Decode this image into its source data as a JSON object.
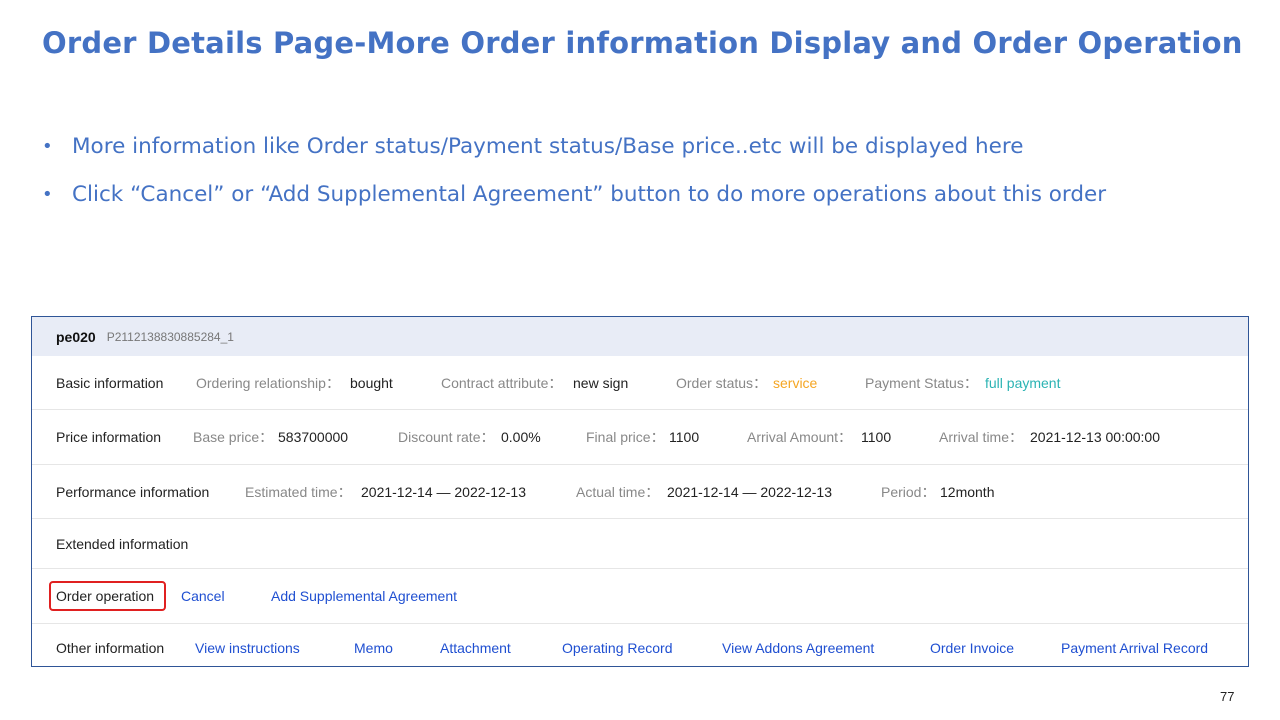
{
  "slide": {
    "title": "Order Details Page-More Order information Display and Order Operation",
    "bullet_char": "•",
    "bullets": [
      "More information like Order status/Payment status/Base price..etc will be displayed here",
      "Click “Cancel” or “Add Supplemental Agreement” button to do more operations about this order"
    ],
    "page_number": "77"
  },
  "order": {
    "name": "pe020",
    "code": "P2112138830885284_1",
    "basic": {
      "label": "Basic information",
      "ordering_relationship_key": "Ordering relationship：",
      "ordering_relationship_val": "bought",
      "contract_attribute_key": "Contract attribute：",
      "contract_attribute_val": "new sign",
      "order_status_key": "Order status：",
      "order_status_val": "service",
      "payment_status_key": "Payment Status：",
      "payment_status_val": "full payment"
    },
    "price": {
      "label": "Price information",
      "base_price_key": "Base price：",
      "base_price_val": "583700000",
      "discount_rate_key": "Discount rate：",
      "discount_rate_val": "0.00%",
      "final_price_key": "Final price：",
      "final_price_val": "1100",
      "arrival_amount_key": "Arrival Amount：",
      "arrival_amount_val": "1100",
      "arrival_time_key": "Arrival time：",
      "arrival_time_val": "2021-12-13 00:00:00"
    },
    "performance": {
      "label": "Performance information",
      "estimated_time_key": "Estimated time：",
      "estimated_time_val": "2021-12-14 — 2022-12-13",
      "actual_time_key": "Actual time：",
      "actual_time_val": "2021-12-14 — 2022-12-13",
      "period_key": "Period：",
      "period_val": "12month"
    },
    "extended": {
      "label": "Extended information"
    },
    "operation": {
      "label": "Order operation",
      "cancel": "Cancel",
      "add_supplemental": "Add Supplemental Agreement"
    },
    "other": {
      "label": "Other information",
      "links": [
        "View instructions",
        "Memo",
        "Attachment",
        "Operating Record",
        "View Addons Agreement",
        "Order Invoice",
        "Payment Arrival Record"
      ]
    }
  },
  "colors": {
    "title": "#4472c4",
    "link": "#1f4fd1",
    "status_orange": "#f5a623",
    "status_teal": "#2bb3b3",
    "highlight_box": "#e02020",
    "panel_border": "#2f5597",
    "header_bg": "#e8ecf6"
  }
}
